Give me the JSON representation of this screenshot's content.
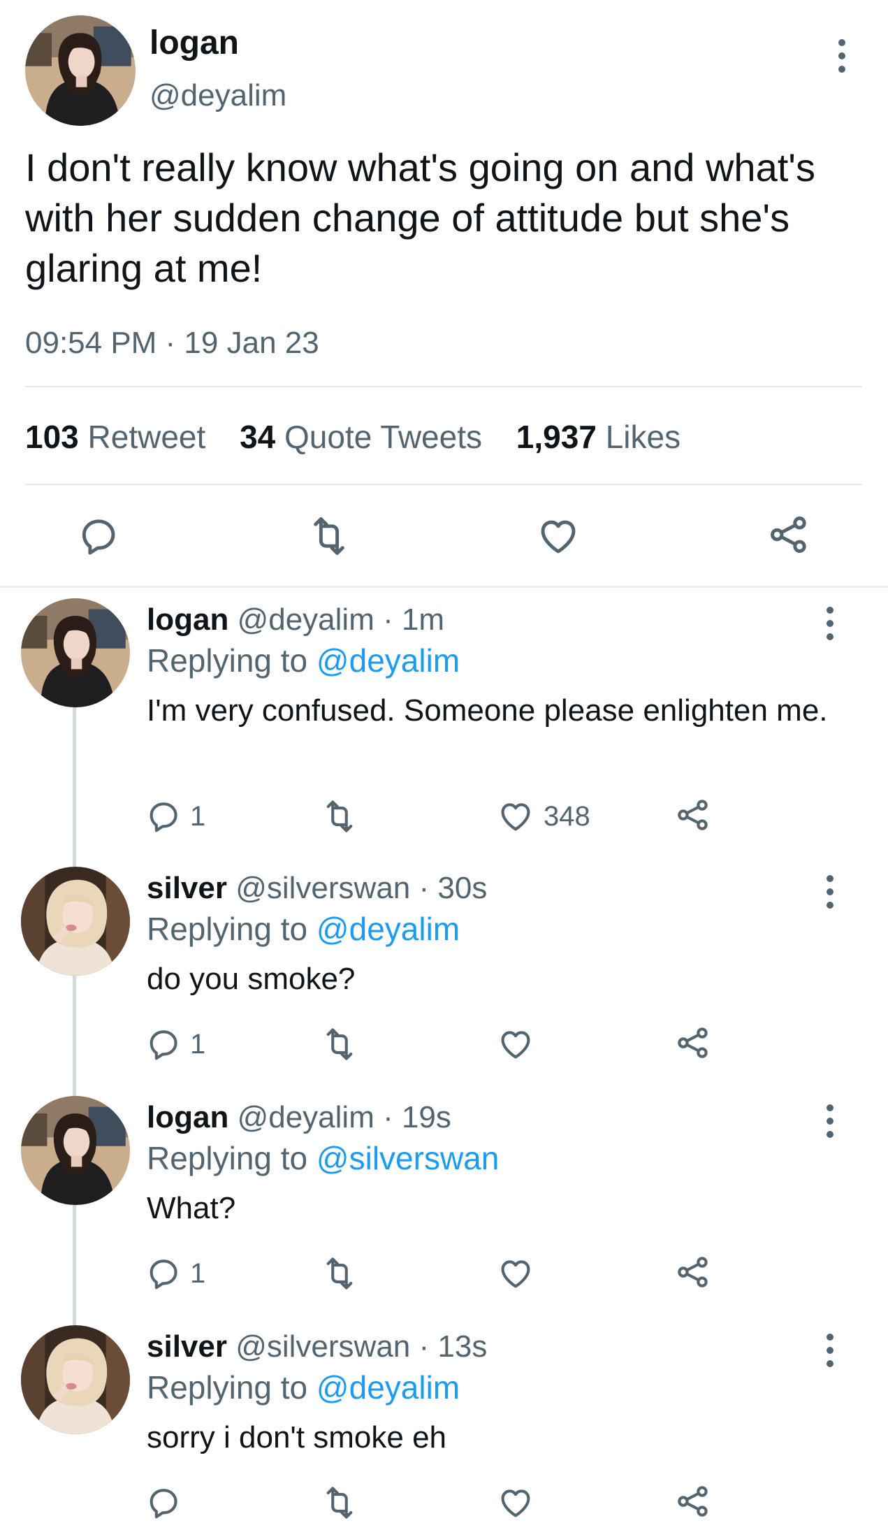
{
  "main_tweet": {
    "display_name": "logan",
    "handle": "@deyalim",
    "text": "I don't really know what's going on and what's with her sudden change of attitude but she's glaring at me!",
    "timestamp": "09:54 PM · 19 Jan 23",
    "stats": {
      "retweets_count": "103",
      "retweets_label": "Retweet",
      "quotes_count": "34",
      "quotes_label": "Quote Tweets",
      "likes_count": "1,937",
      "likes_label": "Likes"
    },
    "actions": [
      "reply-icon",
      "retweet-icon",
      "heart-icon",
      "share-icon"
    ]
  },
  "replies": [
    {
      "display_name": "logan",
      "handle": "@deyalim",
      "time": "· 1m",
      "replying_prefix": "Replying to",
      "replying_to": "@deyalim",
      "text": "I'm very confused. Someone please enlighten me.",
      "reply_count": "1",
      "like_count": "348"
    },
    {
      "display_name": "silver",
      "handle": "@silverswan",
      "time": "· 30s",
      "replying_prefix": "Replying to",
      "replying_to": "@deyalim",
      "text": "do you smoke?",
      "reply_count": "1"
    },
    {
      "display_name": "logan",
      "handle": "@deyalim",
      "time": "· 19s",
      "replying_prefix": "Replying to",
      "replying_to": "@silverswan",
      "text": "What?",
      "reply_count": "1"
    },
    {
      "display_name": "silver",
      "handle": "@silverswan",
      "time": "· 13s",
      "replying_prefix": "Replying to",
      "replying_to": "@deyalim",
      "text": "sorry i don't smoke eh"
    }
  ],
  "colors": {
    "text": "#0f1419",
    "muted": "#536471",
    "link": "#1d9bf0",
    "thread_line": "#cfd9de"
  }
}
